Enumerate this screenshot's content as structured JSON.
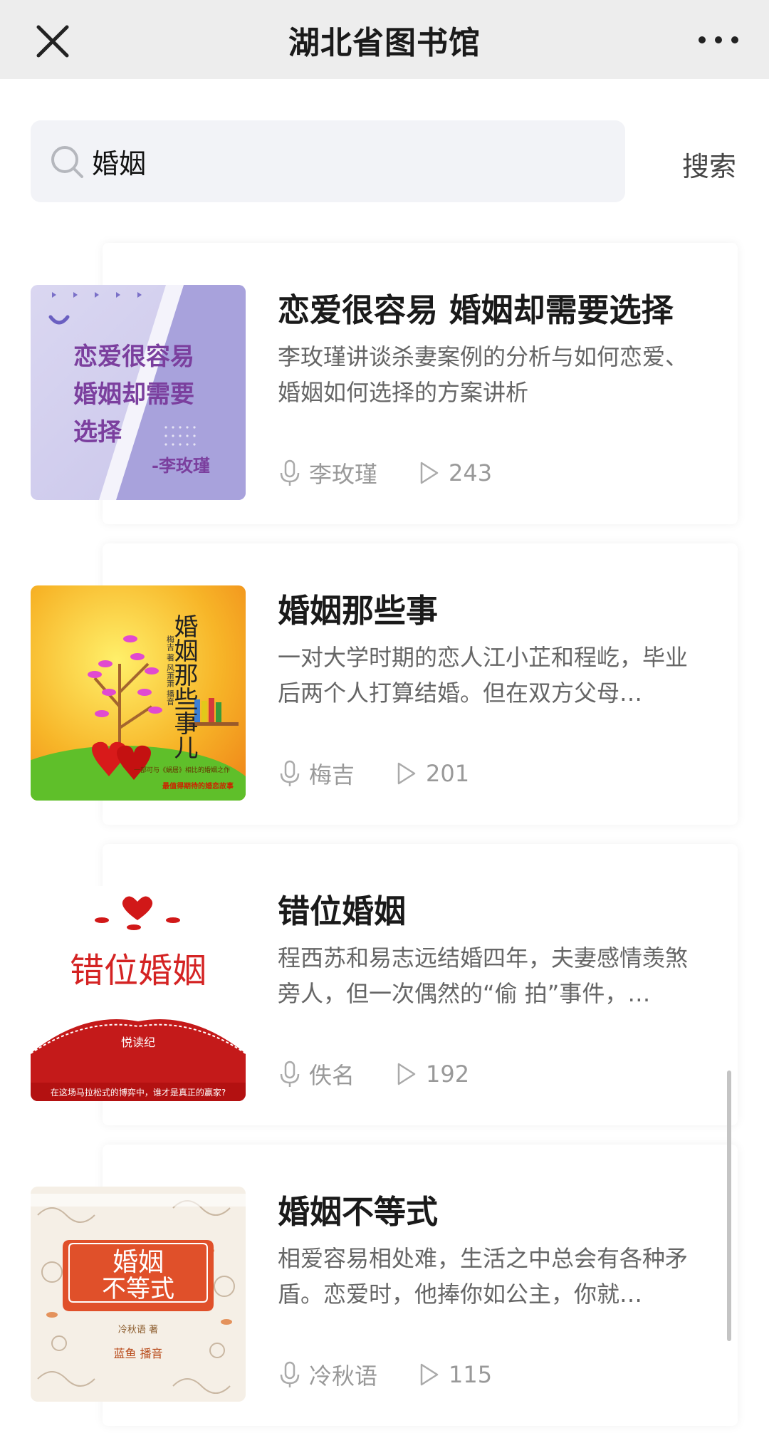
{
  "header": {
    "title": "湖北省图书馆"
  },
  "search": {
    "value": "婚姻",
    "button_label": "搜索"
  },
  "results": [
    {
      "title": "恋爱很容易 婚姻却需要选择",
      "desc": "李玫瑾讲谈杀妻案例的分析与如何恋爱、 婚姻如何选择的方案讲析",
      "author": "李玫瑾",
      "plays": "243",
      "cover_text": [
        "恋爱很容易",
        "婚姻却需要",
        "选择",
        "-李玫瑾"
      ]
    },
    {
      "title": "婚姻那些事",
      "desc": "一对大学时期的恋人江小芷和程屹，毕业后两个人打算结婚。但在双方父母…",
      "author": "梅吉",
      "plays": "201",
      "cover_text": [
        "婚姻那些事儿",
        "梅吉 著 风萧萧 播音",
        "一部可与《蜗居》相比的婚姻之作",
        "最值得期待的婚恋故事"
      ]
    },
    {
      "title": "错位婚姻",
      "desc": "程西苏和易志远结婚四年，夫妻感情羡煞旁人，但一次偶然的“偷 拍”事件，…",
      "author": "佚名",
      "plays": "192",
      "cover_text": [
        "错位婚姻",
        "悦读纪",
        "在这场马拉松式的博弈中，谁才是真正的赢家?"
      ]
    },
    {
      "title": "婚姻不等式",
      "desc": "相爱容易相处难，生活之中总会有各种矛盾。恋爱时，他捧你如公主，你就…",
      "author": "冷秋语",
      "plays": "115",
      "cover_text": [
        "婚姻",
        "不等式",
        "蓝鱼 播音",
        "冷秋语 著"
      ]
    }
  ]
}
